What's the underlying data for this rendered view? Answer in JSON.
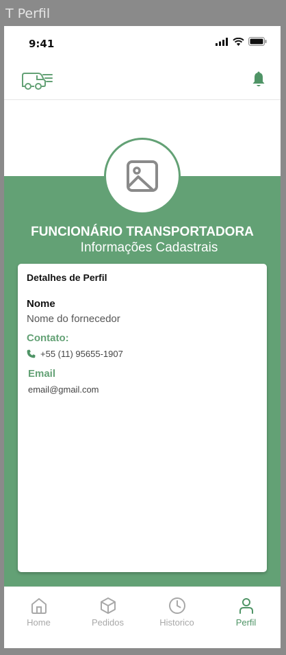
{
  "frame": {
    "title": "T Perfil"
  },
  "status_bar": {
    "time": "9:41"
  },
  "profile": {
    "title": "FUNCIONÁRIO TRANSPORTADORA",
    "subtitle": "Informações Cadastrais"
  },
  "details": {
    "heading": "Detalhes de Perfil",
    "name_label": "Nome",
    "name_value": "Nome do fornecedor",
    "contact_label": "Contato:",
    "phone": "+55 (11) 95655-1907",
    "email_label": "Email",
    "email_value": "email@gmail.com"
  },
  "nav": {
    "items": [
      {
        "label": "Home",
        "icon": "home-icon",
        "active": false
      },
      {
        "label": "Pedidos",
        "icon": "box-icon",
        "active": false
      },
      {
        "label": "Historico",
        "icon": "clock-icon",
        "active": false
      },
      {
        "label": "Perfil",
        "icon": "user-icon",
        "active": true
      }
    ]
  },
  "colors": {
    "accent": "#63a175",
    "accent_dark": "#4f9466",
    "inactive": "#a8a8a8"
  }
}
